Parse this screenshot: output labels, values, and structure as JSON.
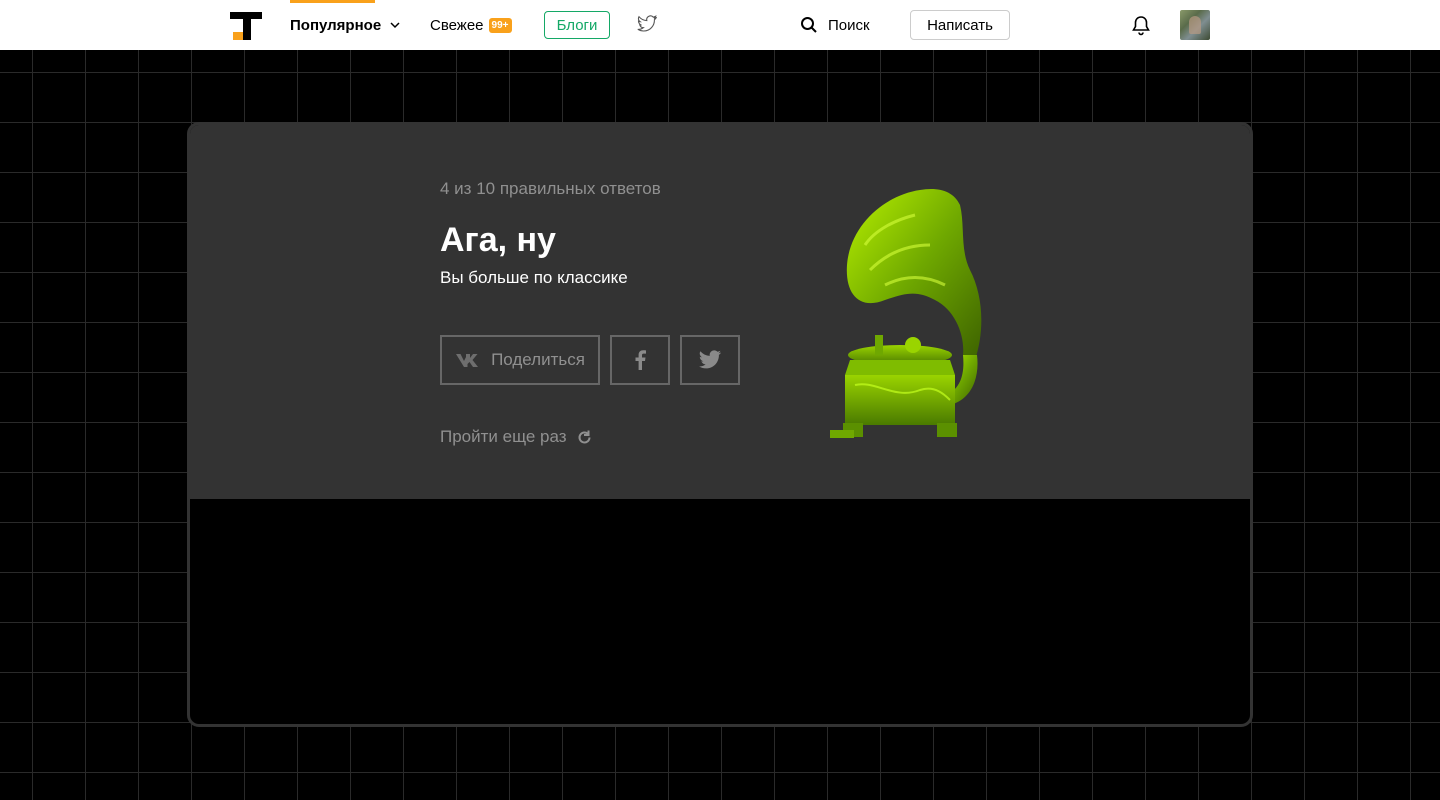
{
  "header": {
    "nav": {
      "popular": "Популярное",
      "fresh": "Свежее",
      "fresh_badge": "99+",
      "blogs": "Блоги"
    },
    "search_label": "Поиск",
    "write_label": "Написать"
  },
  "colors": {
    "accent": "#f9a11b",
    "blogs_green": "#14a866",
    "card_bg": "#333333",
    "gramophone": "#8bc400"
  },
  "icons": [
    "logo-icon",
    "chevron-down-icon",
    "twitter-icon",
    "search-icon",
    "bell-icon",
    "avatar",
    "vk-icon",
    "facebook-icon",
    "twitter-icon",
    "refresh-icon",
    "gramophone-image"
  ],
  "result": {
    "score_text": "4 из 10 правильных ответов",
    "title": "Ага, ну",
    "subtitle": "Вы больше по классике",
    "share_label": "Поделиться",
    "retry_label": "Пройти еще раз"
  }
}
